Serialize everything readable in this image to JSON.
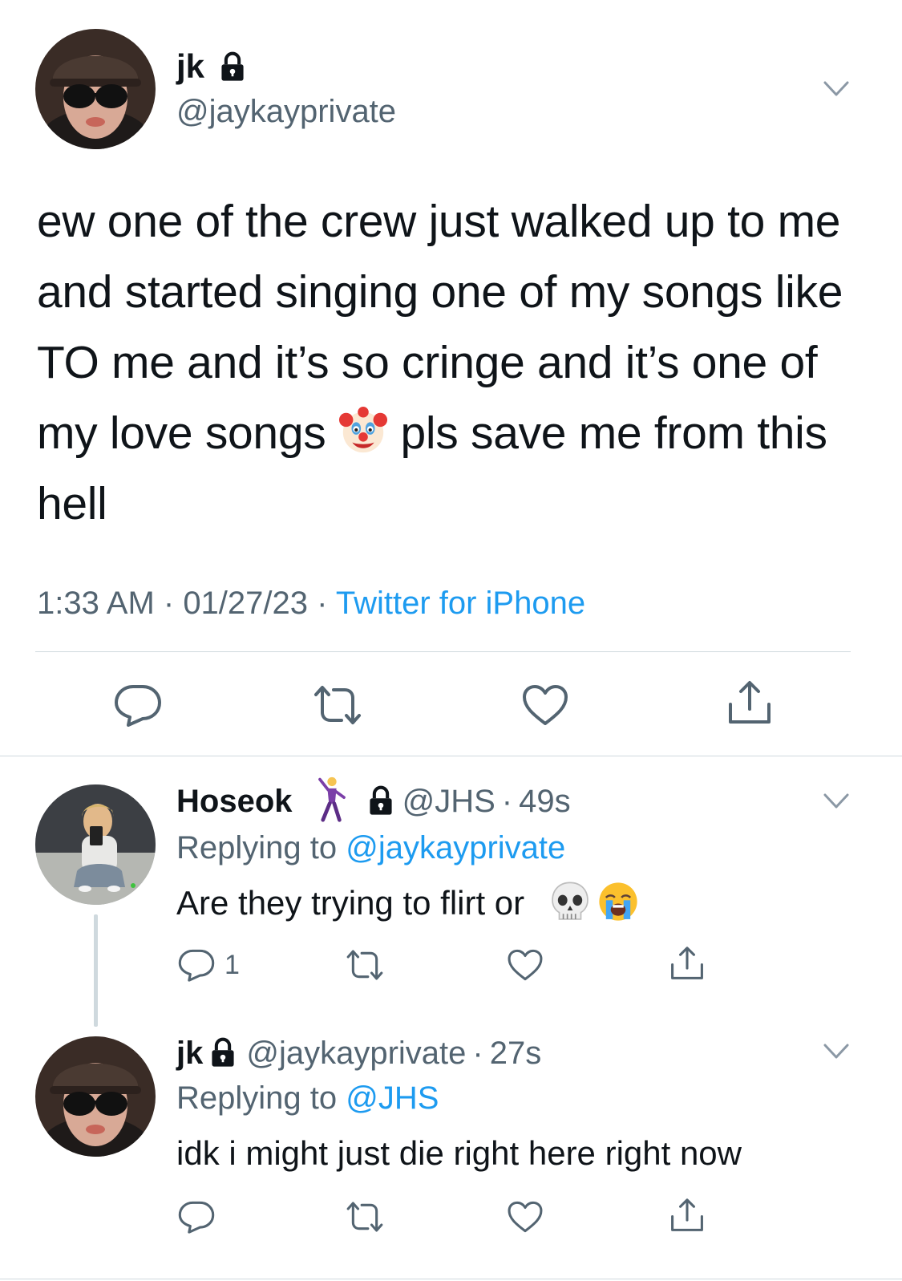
{
  "main_tweet": {
    "display_name": "jk",
    "handle": "@jaykayprivate",
    "text_part1": "ew one of the crew just walked up to me and started singing one of my songs like TO me and it’s so cringe and it’s one of my love songs ",
    "text_emoji": "clown-face",
    "text_part2": " pls save me from this hell",
    "time": "1:33 AM",
    "date": "01/27/23",
    "separator": " · ",
    "source": "Twitter for iPhone"
  },
  "reply1": {
    "display_name": "Hoseok",
    "name_emoji": "man-dancing",
    "handle": "@JHS",
    "age": "49s",
    "dot": "·",
    "replying_prefix": "Replying to ",
    "replying_handle": "@jaykayprivate",
    "text": "Are they trying to flirt or ",
    "text_emojis": [
      "skull",
      "loudly-crying-face"
    ],
    "reply_count": "1"
  },
  "reply2": {
    "display_name": "jk",
    "handle": "@jaykayprivate",
    "age": "27s",
    "dot": "·",
    "replying_prefix": "Replying to ",
    "replying_handle": "@JHS",
    "text": "idk i might just die right here right now"
  },
  "icons": {
    "lock": "lock-icon",
    "chevron": "chevron-down-icon",
    "reply": "reply-icon",
    "retweet": "retweet-icon",
    "like": "heart-icon",
    "share": "share-icon"
  },
  "colors": {
    "link": "#1d9bf0",
    "muted": "#536471",
    "text": "#0f1419",
    "divider": "#cfd9de"
  }
}
